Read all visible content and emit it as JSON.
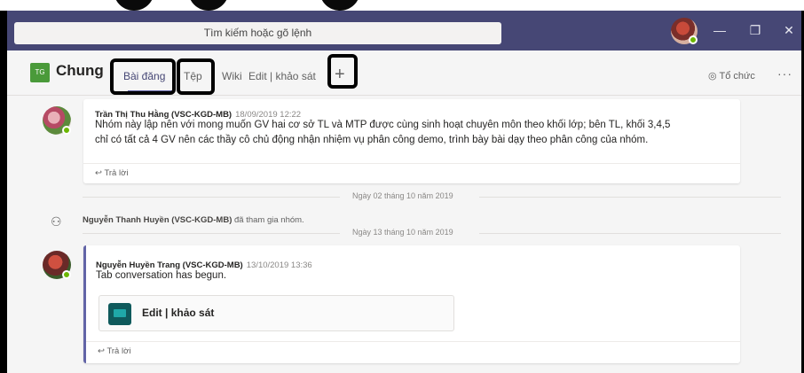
{
  "titlebar": {
    "search_placeholder": "Tìm kiếm hoặc gõ lệnh",
    "minimize_label": "—",
    "restore_label": "❐",
    "close_label": "✕"
  },
  "channel": {
    "team_initials": "TG",
    "name": "Chung",
    "tabs": [
      "Bài đăng",
      "Tệp",
      "Wiki",
      "Edit | khảo sát"
    ],
    "add_tab_label": "+",
    "org_label": "Tổ chức",
    "more_label": "···"
  },
  "messages": [
    {
      "author": "Trần Thị Thu Hằng (VSC-KGD-MB)",
      "timestamp": "18/09/2019 12:22",
      "lines": [
        "Nhóm này lập nên với mong muốn GV hai cơ sở TL và MTP được cùng sinh hoạt chuyên môn theo khối lớp; bên TL, khối 3,4,5",
        "chỉ có tất cả 4 GV nên các thầy cô chủ động nhận nhiệm vụ phân công demo, trình bày bài dạy theo phân công của nhóm."
      ],
      "reply_label": "Trả lời"
    },
    {
      "author": "Nguyễn Huyền Trang (VSC-KGD-MB)",
      "timestamp": "13/10/2019 13:36",
      "lines": [
        "Tab conversation has begun."
      ],
      "attachment_title": "Edit | khảo sát",
      "reply_label": "Trả lời"
    }
  ],
  "dates": [
    "Ngày 02 tháng 10 năm 2019",
    "Ngày 13 tháng 10 năm 2019"
  ],
  "system_event": {
    "actor": "Nguyễn Thanh Huyền (VSC-KGD-MB)",
    "action": "đã tham gia nhóm."
  },
  "colors": {
    "titlebar": "#464775",
    "accent": "#6264a7",
    "team_tile": "#4a9a3a",
    "presence": "#6bb700"
  }
}
